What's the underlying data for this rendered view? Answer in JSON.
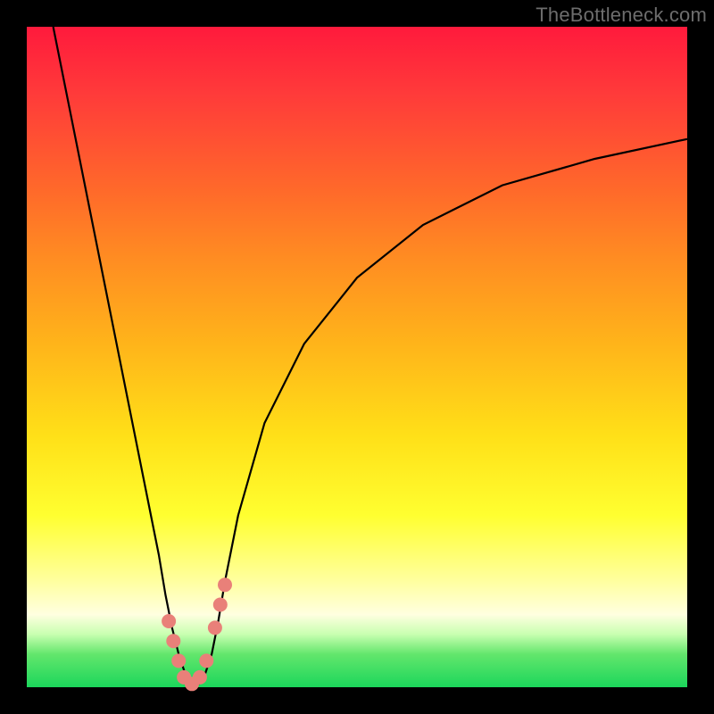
{
  "watermark": "TheBottleneck.com",
  "chart_data": {
    "type": "line",
    "title": "",
    "xlabel": "",
    "ylabel": "",
    "xlim": [
      0,
      100
    ],
    "ylim": [
      0,
      100
    ],
    "background": "rainbow-vertical",
    "series": [
      {
        "name": "curve",
        "x": [
          4,
          6,
          8,
          10,
          12,
          14,
          16,
          18,
          20,
          21,
          22,
          23,
          24,
          25,
          26,
          27,
          28,
          29,
          30,
          32,
          36,
          42,
          50,
          60,
          72,
          86,
          100
        ],
        "y": [
          100,
          90,
          80,
          70,
          60,
          50,
          40,
          30,
          20,
          14,
          9,
          5,
          2,
          0.5,
          0.5,
          2,
          5,
          10,
          16,
          26,
          40,
          52,
          62,
          70,
          76,
          80,
          83
        ]
      }
    ],
    "markers": [
      {
        "x": 21.5,
        "y": 10.0
      },
      {
        "x": 22.2,
        "y": 7.0
      },
      {
        "x": 23.0,
        "y": 4.0
      },
      {
        "x": 23.8,
        "y": 1.5
      },
      {
        "x": 25.0,
        "y": 0.5
      },
      {
        "x": 26.2,
        "y": 1.5
      },
      {
        "x": 27.2,
        "y": 4.0
      },
      {
        "x": 28.5,
        "y": 9.0
      },
      {
        "x": 29.3,
        "y": 12.5
      },
      {
        "x": 30.0,
        "y": 15.5
      }
    ],
    "marker_color": "#e98079",
    "marker_radius_px": 8
  }
}
